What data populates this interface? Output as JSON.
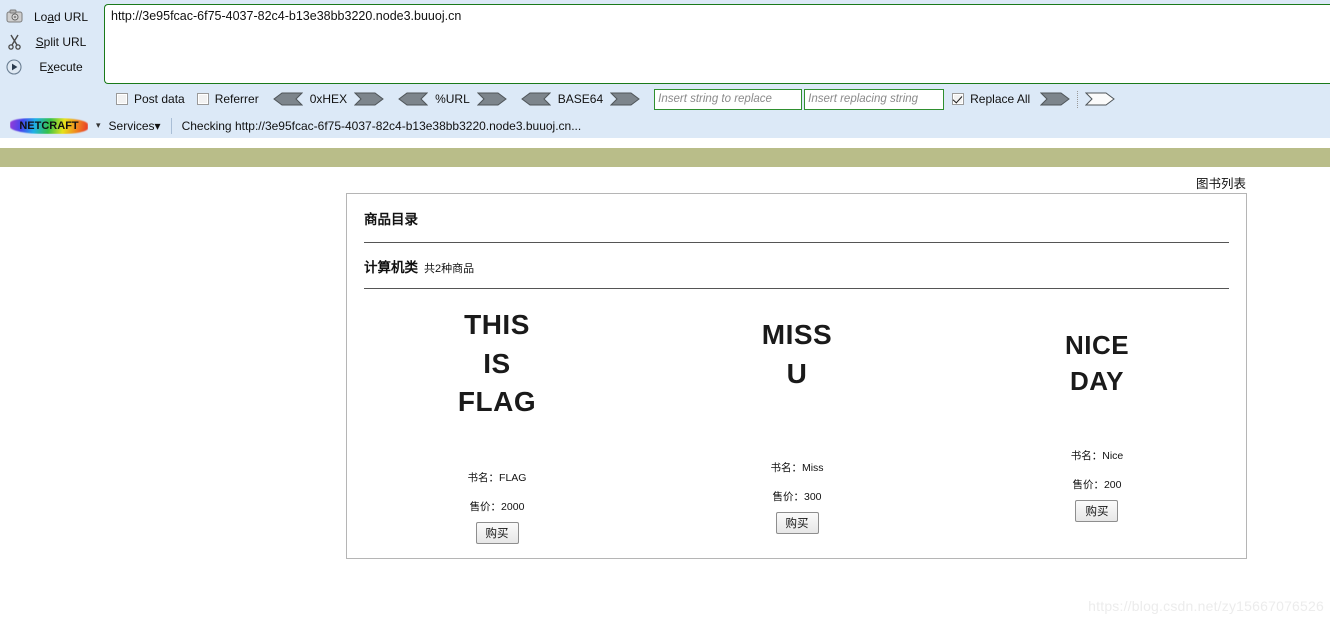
{
  "hackbar": {
    "commands": [
      {
        "icon": "load-url-icon",
        "label_pre": "Lo",
        "label_accel": "a",
        "label_post": "d URL"
      },
      {
        "icon": "scissors-icon",
        "label_pre": "",
        "label_accel": "S",
        "label_post": "plit URL"
      },
      {
        "icon": "execute-play-icon",
        "label_pre": "E",
        "label_accel": "x",
        "label_post": "ecute"
      }
    ],
    "url_value": "http://3e95fcac-6f75-4037-82c4-b13e38bb3220.node3.buuoj.cn",
    "options": {
      "post_data_label": "Post data",
      "post_data_checked": false,
      "referrer_label": "Referrer",
      "referrer_checked": false,
      "encoders": [
        "0xHEX",
        "%URL",
        "BASE64"
      ],
      "replace_from_placeholder": "Insert string to replace",
      "replace_to_placeholder": "Insert replacing string",
      "replace_from_value": "",
      "replace_to_value": "",
      "replace_all_label": "Replace All",
      "replace_all_checked": true
    },
    "netcraft": {
      "logo_text": "NETCRAFT",
      "services_label": "Services",
      "status": "Checking http://3e95fcac-6f75-4037-82c4-b13e38bb3220.node3.buuoj.cn..."
    },
    "colors": {
      "toolbar_bg": "#dce9f7",
      "url_border": "#1a7a1a",
      "olive_bar": "#b9bd89"
    }
  },
  "page": {
    "booklist_link": "图书列表",
    "card_title": "商品目录",
    "category_name": "计算机类",
    "category_count": "共2种商品",
    "products": [
      {
        "cover_lines": [
          "THIS",
          "IS",
          "FLAG"
        ],
        "name_label": "书名：FLAG",
        "price_label": "售价：2000",
        "buy_label": "购买"
      },
      {
        "cover_lines": [
          "MISS",
          "U"
        ],
        "name_label": "书名：Miss",
        "price_label": "售价：300",
        "buy_label": "购买"
      },
      {
        "cover_lines": [
          "NICE",
          "DAY"
        ],
        "name_label": "书名：Nice",
        "price_label": "售价：200",
        "buy_label": "购买"
      }
    ],
    "watermark": "https://blog.csdn.net/zy15667076526"
  }
}
